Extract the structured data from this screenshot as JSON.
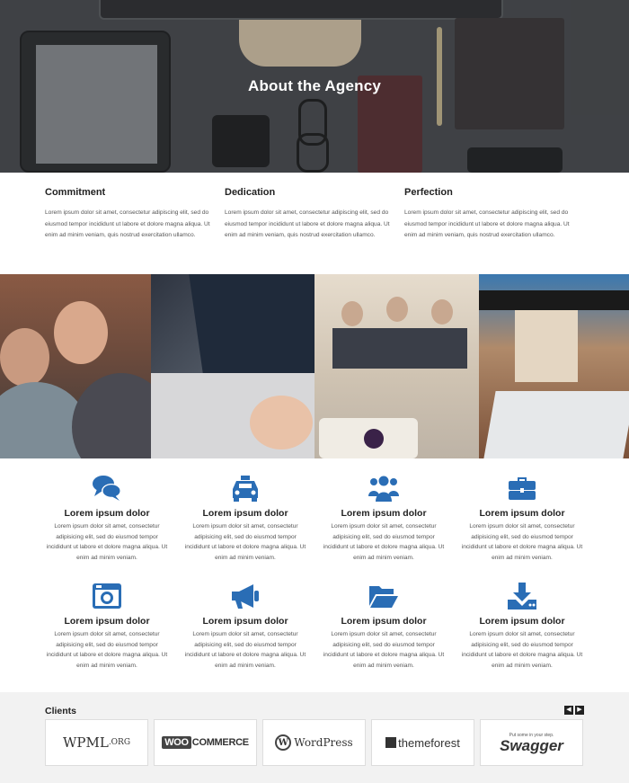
{
  "hero": {
    "title": "About the Agency"
  },
  "values": [
    {
      "title": "Commitment",
      "text": "Lorem ipsum dolor sit amet, consectetur adipiscing elit, sed do eiusmod tempor incididunt ut labore et dolore magna aliqua. Ut enim ad minim veniam, quis nostrud exercitation ullamco."
    },
    {
      "title": "Dedication",
      "text": "Lorem ipsum dolor sit amet, consectetur adipiscing elit, sed do eiusmod tempor incididunt ut labore et dolore magna aliqua. Ut enim ad minim veniam, quis nostrud exercitation ullamco."
    },
    {
      "title": "Perfection",
      "text": "Lorem ipsum dolor sit amet, consectetur adipiscing elit, sed do eiusmod tempor incididunt ut labore et dolore magna aliqua. Ut enim ad minim veniam, quis nostrud exercitation ullamco."
    }
  ],
  "features": [
    {
      "icon": "chat-icon",
      "title": "Lorem ipsum dolor",
      "text": "Lorem ipsum dolor sit amet, consectetur adipisicing elit, sed do eiusmod tempor incididunt ut labore et dolore magna aliqua. Ut enim ad minim veniam."
    },
    {
      "icon": "taxi-icon",
      "title": "Lorem ipsum dolor",
      "text": "Lorem ipsum dolor sit amet, consectetur adipisicing elit, sed do eiusmod tempor incididunt ut labore et dolore magna aliqua. Ut enim ad minim veniam."
    },
    {
      "icon": "group-icon",
      "title": "Lorem ipsum dolor",
      "text": "Lorem ipsum dolor sit amet, consectetur adipisicing elit, sed do eiusmod tempor incididunt ut labore et dolore magna aliqua. Ut enim ad minim veniam."
    },
    {
      "icon": "briefcase-icon",
      "title": "Lorem ipsum dolor",
      "text": "Lorem ipsum dolor sit amet, consectetur adipisicing elit, sed do eiusmod tempor incididunt ut labore et dolore magna aliqua. Ut enim ad minim veniam."
    },
    {
      "icon": "camera-icon",
      "title": "Lorem ipsum dolor",
      "text": "Lorem ipsum dolor sit amet, consectetur adipisicing elit, sed do eiusmod tempor incididunt ut labore et dolore magna aliqua. Ut enim ad minim veniam."
    },
    {
      "icon": "megaphone-icon",
      "title": "Lorem ipsum dolor",
      "text": "Lorem ipsum dolor sit amet, consectetur adipisicing elit, sed do eiusmod tempor incididunt ut labore et dolore magna aliqua. Ut enim ad minim veniam."
    },
    {
      "icon": "folder-open-icon",
      "title": "Lorem ipsum dolor",
      "text": "Lorem ipsum dolor sit amet, consectetur adipisicing elit, sed do eiusmod tempor incididunt ut labore et dolore magna aliqua. Ut enim ad minim veniam."
    },
    {
      "icon": "download-icon",
      "title": "Lorem ipsum dolor",
      "text": "Lorem ipsum dolor sit amet, consectetur adipisicing elit, sed do eiusmod tempor incididunt ut labore et dolore magna aliqua. Ut enim ad minim veniam."
    }
  ],
  "clients": {
    "title": "Clients",
    "prev_label": "◀",
    "next_label": "▶",
    "logos": {
      "wpml": "WPML",
      "wpml_suffix": ".ORG",
      "woo_box": "WOO",
      "woo_rest": "COMMERCE",
      "wp_w": "W",
      "wp_name": "WordPress",
      "tf_name": "themeforest",
      "swagger_tag": "Put some in your step.",
      "swagger_name": "Swagger"
    }
  },
  "colors": {
    "accent": "#2a6db5",
    "clients_bg": "#f2f2f2"
  }
}
